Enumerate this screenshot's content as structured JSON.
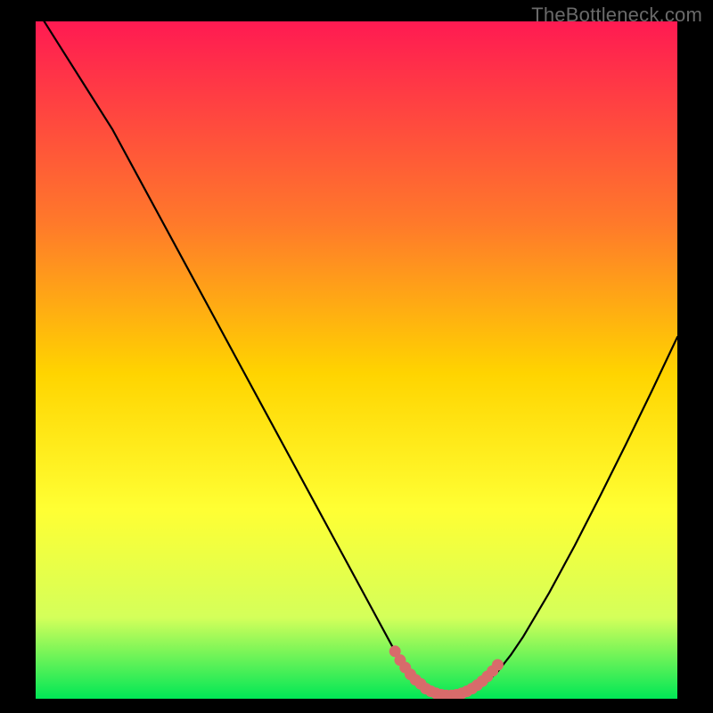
{
  "watermark": "TheBottleneck.com",
  "colors": {
    "background": "#000000",
    "gradient_top": "#ff1a52",
    "gradient_mid_upper": "#ff7a2a",
    "gradient_mid": "#ffd400",
    "gradient_mid_lower": "#ffff33",
    "gradient_lower": "#d4ff5a",
    "gradient_bottom": "#00e756",
    "curve": "#000000",
    "marker": "#d86b6b"
  },
  "chart_data": {
    "type": "line",
    "title": "",
    "xlabel": "",
    "ylabel": "",
    "xlim": [
      0,
      100
    ],
    "ylim": [
      0,
      100
    ],
    "series": [
      {
        "name": "bottleneck-curve",
        "x": [
          0,
          4,
          8,
          12,
          16,
          20,
          24,
          28,
          32,
          36,
          40,
          44,
          48,
          52,
          56,
          57,
          58,
          60,
          62,
          64,
          66,
          68,
          70,
          72,
          74,
          76,
          80,
          84,
          88,
          92,
          96,
          100
        ],
        "y": [
          102,
          96,
          90,
          84,
          77,
          70,
          63,
          56,
          49,
          42,
          35,
          28,
          21,
          14,
          7,
          5.5,
          4,
          2.2,
          1.0,
          0.5,
          0.5,
          1.0,
          2.2,
          4.0,
          6.4,
          9.2,
          15.6,
          22.6,
          30.0,
          37.6,
          45.4,
          53.4
        ]
      }
    ],
    "markers": {
      "name": "optimal-range",
      "x": [
        56.0,
        56.8,
        57.6,
        58.4,
        59.2,
        60.0,
        60.8,
        61.6,
        62.4,
        63.2,
        64.0,
        64.8,
        65.6,
        66.4,
        67.2,
        68.0,
        68.8,
        69.6,
        70.4,
        71.2,
        72.0
      ],
      "y": [
        7.0,
        5.7,
        4.6,
        3.6,
        2.8,
        2.2,
        1.5,
        1.1,
        0.8,
        0.6,
        0.5,
        0.5,
        0.6,
        0.8,
        1.1,
        1.5,
        2.0,
        2.6,
        3.3,
        4.1,
        5.0
      ]
    }
  }
}
